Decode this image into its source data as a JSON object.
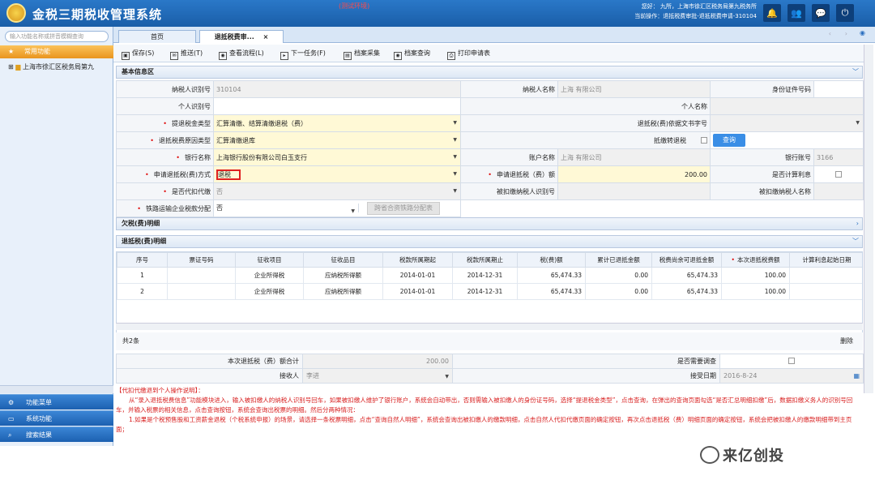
{
  "header": {
    "title": "金税三期税收管理系统",
    "env": "(测试环境)",
    "user_line": "您好：    九所，上海市徐汇区税务局第九税务所",
    "op_line": "当前操作：退抵税费审批-退抵税费申请-310104"
  },
  "icons": {
    "bell": "bell-icon",
    "users": "users-icon",
    "msg": "message-icon",
    "power": "power-icon"
  },
  "sidebar": {
    "search_placeholder": "输入功能名称或拼音模糊查询",
    "common": "常用功能",
    "tree_item": "上海市徐汇区税务局第九",
    "menus": [
      "功能菜单",
      "系统功能",
      "搜索结果"
    ]
  },
  "tabs": {
    "home": "首页",
    "active": "退抵税费审...",
    "close": "×"
  },
  "toolbar": [
    "保存(S)",
    "推送(T)",
    "查看流程(L)",
    "下一任务(F)",
    "档案采集",
    "档案查询",
    "打印申请表"
  ],
  "basic": {
    "title": "基本信息区",
    "nsrsbh_l": "纳税人识别号",
    "nsrsbh_v": "310104",
    "nsrmc_l": "纳税人名称",
    "nsrmc_v": "上海                              有限公司",
    "sfz_l": "身份证件号码",
    "grsbh_l": "个人识别号",
    "grmc_l": "个人名称",
    "ttjlx_l": "提退税金类型",
    "ttjlx_v": "汇算清缴、结算清缴退税（费）",
    "wsh_l": "退抵税(费)依据文书字号",
    "ydlx_l": "退抵税费原因类型",
    "ydlx_v": "汇算清缴退库",
    "dj_l": "抵缴转退税",
    "query": "查询",
    "yh_l": "银行名称",
    "yh_v": "上海银行股份有限公司白玉支行",
    "zh_l": "账户名称",
    "zh_v": "上海                              有限公司",
    "yhzh_l": "银行账号",
    "yhzh_v": "3166",
    "fs_l": "申请退抵税(费)方式",
    "fs_v": "退税",
    "je_l": "申请退抵税（费）额",
    "je_v": "200.00",
    "lx_l": "是否计算利息",
    "dk_l": "是否代扣代缴",
    "dk_v": "否",
    "bk_l": "被扣缴纳税人识别号",
    "bkmc_l": "被扣缴纳税人名称",
    "tl_l": "铁路运输企业税款分配",
    "tl_v": "否",
    "tl_btn": "跨省合资铁路分配表"
  },
  "sections": {
    "arrears": "欠税(费)明细",
    "detail": "退抵税(费)明细"
  },
  "grid": {
    "headers": [
      "序号",
      "票证号码",
      "征收项目",
      "征收品目",
      "税款所属期起",
      "税款所属期止",
      "税(费)额",
      "累计已退抵金额",
      "税费尚余可退抵金额",
      "本次退抵税费额",
      "计算利息起始日期"
    ],
    "rows": [
      [
        "1",
        "",
        "企业所得税",
        "应纳税所得额",
        "2014-01-01",
        "2014-12-31",
        "65,474.33",
        "0.00",
        "65,474.33",
        "100.00",
        ""
      ],
      [
        "2",
        "",
        "企业所得税",
        "应纳税所得额",
        "2014-01-01",
        "2014-12-31",
        "65,474.33",
        "0.00",
        "65,474.33",
        "100.00",
        ""
      ]
    ],
    "count": "共2条",
    "delete": "删除"
  },
  "bottom": {
    "total_l": "本次退抵税（费）额合计",
    "total_v": "200.00",
    "survey_l": "是否需要调查",
    "recv_l": "接收人",
    "recv_v": "李进",
    "date_l": "接受日期",
    "date_v": "2016-8-24"
  },
  "notes": {
    "title": "【代扣代缴退到个人操作说明】：",
    "p1": "从“录入退抵税费信息”功能模块进入，输入被扣缴人的纳税人识别号回车，如果被扣缴人维护了银行账户，系统会自动带出，否则需输入被扣缴人的身份证号码，选择“提退税金类型”，点击查询，在弹出的查询页面勾选“是否汇总明细扣缴”后，数据扣缴义务人的识别号回车，并输入税票的相关信息，点击查询按钮，系统会查询出税票的明细。然后分两种情况：",
    "p2": "1.如果是个税预售股和工资薪金退税（个税系统申报）的场景，请选择一条税票明细，点击“查询自然人明细”，系统会查询出被扣缴人的缴款明细，点击自然人代扣代缴页面的确定按钮，再次点击退抵税（费）明细页面的确定按钮，系统会把被扣缴人的缴款明细带到主页面；"
  },
  "watermark": "来亿创投"
}
